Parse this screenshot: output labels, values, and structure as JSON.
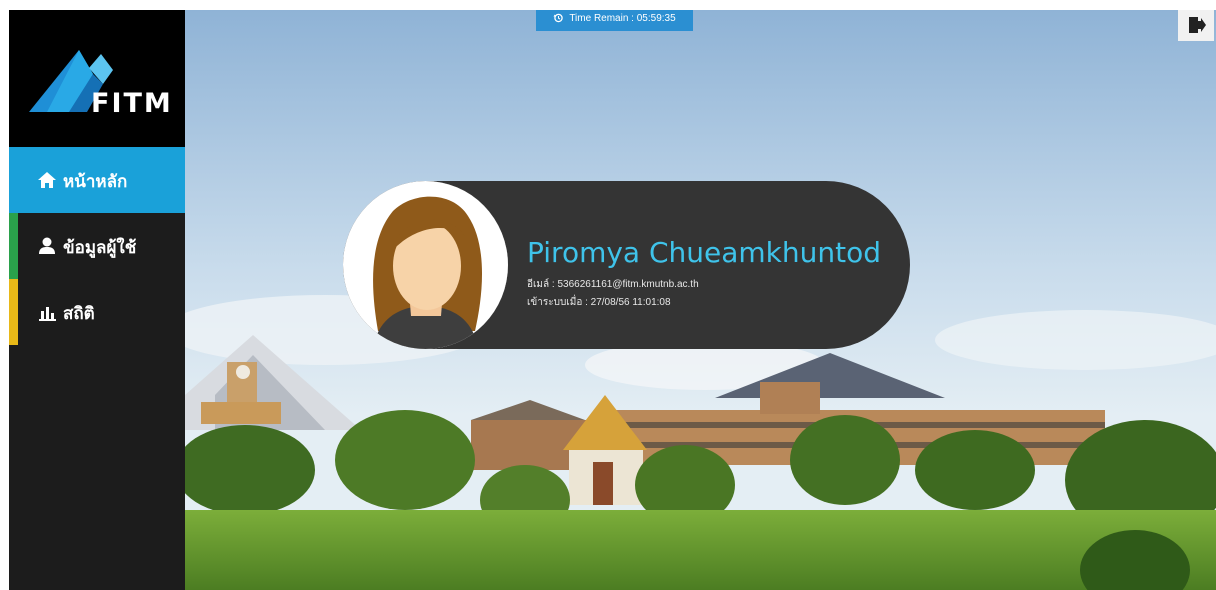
{
  "sidebar": {
    "logo_text": "FITM",
    "items": [
      {
        "label": "หน้าหลัก",
        "icon": "home-icon",
        "accent": "#1aa1d9",
        "active": true
      },
      {
        "label": "ข้อมูลผู้ใช้",
        "icon": "user-icon",
        "accent": "#2aa14b",
        "active": false
      },
      {
        "label": "สถิติ",
        "icon": "bar-chart-icon",
        "accent": "#e8b818",
        "active": false
      }
    ]
  },
  "header": {
    "timer_text": "Time Remain : 05:59:35",
    "timer_icon": "history-icon",
    "logout_icon": "sign-out-icon"
  },
  "profile": {
    "name": "Piromya Chueamkhuntod",
    "email_label": "อีเมล์ : 5366261161@fitm.kmutnb.ac.th",
    "last_login_label": "เข้าระบบเมื่อ : 27/08/56 11:01:08",
    "avatar": "female-avatar-placeholder"
  },
  "colors": {
    "accent_blue": "#1aa1d9",
    "accent_green": "#2aa14b",
    "accent_yellow": "#e8b818",
    "name_color": "#3fc3ea",
    "card_background": "#343434"
  }
}
